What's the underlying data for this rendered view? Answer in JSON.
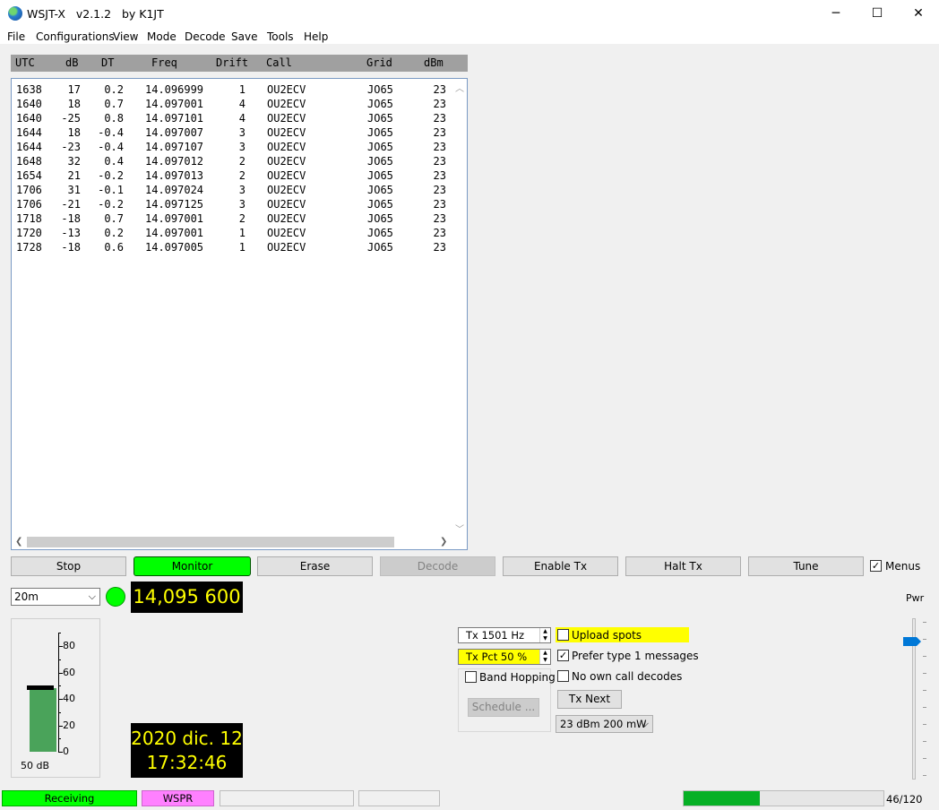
{
  "window": {
    "title": "WSJT-X   v2.1.2   by K1JT",
    "minimize_glyph": "─",
    "maximize_glyph": "☐",
    "close_glyph": "✕"
  },
  "menu": [
    "File",
    "Configurations",
    "View",
    "Mode",
    "Decode",
    "Save",
    "Tools",
    "Help"
  ],
  "table": {
    "columns": [
      "UTC",
      "dB",
      "DT",
      "Freq",
      "Drift",
      "Call",
      "Grid",
      "dBm"
    ],
    "rows": [
      [
        "1638",
        "17",
        "0.2",
        "14.096999",
        "1",
        "OU2ECV",
        "JO65",
        "23"
      ],
      [
        "1640",
        "18",
        "0.7",
        "14.097001",
        "4",
        "OU2ECV",
        "JO65",
        "23"
      ],
      [
        "1640",
        "-25",
        "0.8",
        "14.097101",
        "4",
        "OU2ECV",
        "JO65",
        "23"
      ],
      [
        "1644",
        "18",
        "-0.4",
        "14.097007",
        "3",
        "OU2ECV",
        "JO65",
        "23"
      ],
      [
        "1644",
        "-23",
        "-0.4",
        "14.097107",
        "3",
        "OU2ECV",
        "JO65",
        "23"
      ],
      [
        "1648",
        "32",
        "0.4",
        "14.097012",
        "2",
        "OU2ECV",
        "JO65",
        "23"
      ],
      [
        "1654",
        "21",
        "-0.2",
        "14.097013",
        "2",
        "OU2ECV",
        "JO65",
        "23"
      ],
      [
        "1706",
        "31",
        "-0.1",
        "14.097024",
        "3",
        "OU2ECV",
        "JO65",
        "23"
      ],
      [
        "1706",
        "-21",
        "-0.2",
        "14.097125",
        "3",
        "OU2ECV",
        "JO65",
        "23"
      ],
      [
        "1718",
        "-18",
        "0.7",
        "14.097001",
        "2",
        "OU2ECV",
        "JO65",
        "23"
      ],
      [
        "1720",
        "-13",
        "0.2",
        "14.097001",
        "1",
        "OU2ECV",
        "JO65",
        "23"
      ],
      [
        "1728",
        "-18",
        "0.6",
        "14.097005",
        "1",
        "OU2ECV",
        "JO65",
        "23"
      ]
    ]
  },
  "buttons": {
    "stop": "Stop",
    "monitor": "Monitor",
    "erase": "Erase",
    "decode": "Decode",
    "enable_tx": "Enable Tx",
    "halt_tx": "Halt Tx",
    "tune": "Tune",
    "menus": "Menus",
    "menus_checked": "✓"
  },
  "band": {
    "selected": "20m",
    "arrow": "⌵"
  },
  "dial_frequency": "14,095 600",
  "meter": {
    "ticks": [
      "80",
      "60",
      "40",
      "20",
      "0"
    ],
    "value_label": "50 dB",
    "level_db": 48
  },
  "clock": {
    "date": "2020 dic. 12",
    "time": "17:32:46"
  },
  "controls": {
    "tx_freq": "Tx  1501  Hz",
    "tx_pct": "Tx Pct 50  %",
    "band_hopping": "Band Hopping",
    "schedule": "Schedule ...",
    "upload_spots": "Upload spots",
    "prefer_type1": "Prefer type 1 messages",
    "prefer_type1_checked": "✓",
    "no_own_call": "No own call decodes",
    "tx_next": "Tx Next",
    "power_select": "23 dBm  200 mW"
  },
  "power": {
    "label": "Pwr"
  },
  "status": {
    "receiving": "Receiving",
    "mode": "WSPR",
    "progress_text": "46/120",
    "progress_value": 46,
    "progress_max": 120
  },
  "colors": {
    "accent_green": "#00ff00",
    "display_yellow": "#ffff00",
    "wspr_magenta": "#ff80ff",
    "progress_green": "#06b025"
  }
}
